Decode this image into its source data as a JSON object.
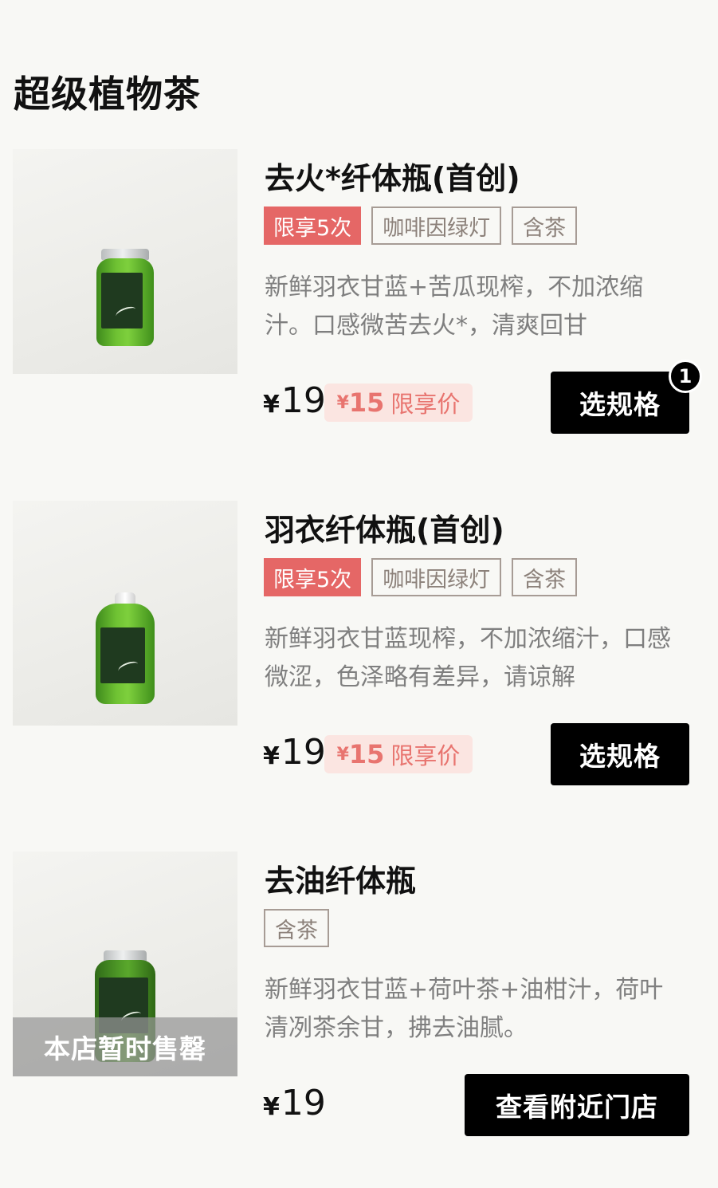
{
  "section": {
    "title": "超级植物茶"
  },
  "products": [
    {
      "name": "去火*纤体瓶(首创)",
      "tags": [
        "限享5次",
        "咖啡因绿灯",
        "含茶"
      ],
      "description": "新鲜羽衣甘蓝+苦瓜现榨，不加浓缩汁。口感微苦去火*，清爽回甘",
      "currency": "¥",
      "price": "19",
      "promo": {
        "currency": "¥",
        "price": "15",
        "label": "限享价"
      },
      "button": "选规格",
      "badge": "1",
      "sold_out": ""
    },
    {
      "name": "羽衣纤体瓶(首创)",
      "tags": [
        "限享5次",
        "咖啡因绿灯",
        "含茶"
      ],
      "description": "新鲜羽衣甘蓝现榨，不加浓缩汁，口感微涩，色泽略有差异，请谅解",
      "currency": "¥",
      "price": "19",
      "promo": {
        "currency": "¥",
        "price": "15",
        "label": "限享价"
      },
      "button": "选规格",
      "badge": "",
      "sold_out": ""
    },
    {
      "name": "去油纤体瓶",
      "tags": [
        "含茶"
      ],
      "description": "新鲜羽衣甘蓝+荷叶茶+油柑汁，荷叶清冽茶余甘，拂去油腻。",
      "currency": "¥",
      "price": "19",
      "promo": null,
      "button": "查看附近门店",
      "badge": "",
      "sold_out": "本店暂时售罄"
    }
  ],
  "colors": {
    "background": "#f8f8f5",
    "limit_tag": "#e56766",
    "promo_bg": "#fbe5e1",
    "promo_text": "#e8746f",
    "button": "#000000"
  },
  "icons": {
    "product_image": "green-juice-bottle-image"
  }
}
